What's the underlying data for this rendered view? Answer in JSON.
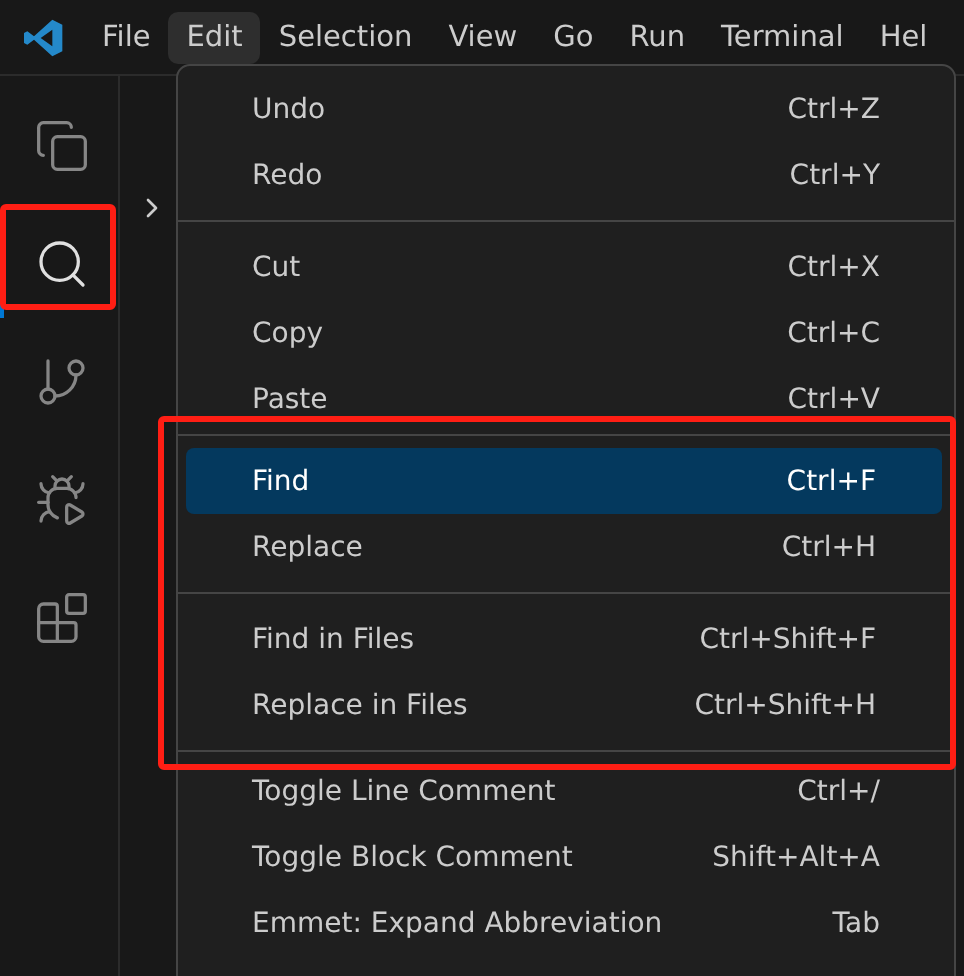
{
  "title_bar": {
    "menus": [
      {
        "label": "File",
        "selected": false
      },
      {
        "label": "Edit",
        "selected": true
      },
      {
        "label": "Selection",
        "selected": false
      },
      {
        "label": "View",
        "selected": false
      },
      {
        "label": "Go",
        "selected": false
      },
      {
        "label": "Run",
        "selected": false
      },
      {
        "label": "Terminal",
        "selected": false
      },
      {
        "label": "Hel",
        "selected": false
      }
    ]
  },
  "activity_bar": {
    "items": [
      {
        "kind": "files",
        "selected": false,
        "highlighted": false
      },
      {
        "kind": "search",
        "selected": true,
        "highlighted": true
      },
      {
        "kind": "source-control",
        "selected": false,
        "highlighted": false
      },
      {
        "kind": "run-debug",
        "selected": false,
        "highlighted": false
      },
      {
        "kind": "extensions",
        "selected": false,
        "highlighted": false
      }
    ]
  },
  "edit_menu": {
    "sections": [
      {
        "highlighted": false,
        "groups": [
          [
            {
              "label": "Undo",
              "shortcut": "Ctrl+Z",
              "selected": false
            },
            {
              "label": "Redo",
              "shortcut": "Ctrl+Y",
              "selected": false
            }
          ],
          [
            {
              "label": "Cut",
              "shortcut": "Ctrl+X",
              "selected": false
            },
            {
              "label": "Copy",
              "shortcut": "Ctrl+C",
              "selected": false
            },
            {
              "label": "Paste",
              "shortcut": "Ctrl+V",
              "selected": false
            }
          ]
        ]
      },
      {
        "highlighted": true,
        "groups": [
          [
            {
              "label": "Find",
              "shortcut": "Ctrl+F",
              "selected": true
            },
            {
              "label": "Replace",
              "shortcut": "Ctrl+H",
              "selected": false
            }
          ],
          [
            {
              "label": "Find in Files",
              "shortcut": "Ctrl+Shift+F",
              "selected": false
            },
            {
              "label": "Replace in Files",
              "shortcut": "Ctrl+Shift+H",
              "selected": false
            }
          ]
        ]
      },
      {
        "highlighted": false,
        "groups": [
          [
            {
              "label": "Toggle Line Comment",
              "shortcut": "Ctrl+/",
              "selected": false
            },
            {
              "label": "Toggle Block Comment",
              "shortcut": "Shift+Alt+A",
              "selected": false
            },
            {
              "label": "Emmet: Expand Abbreviation",
              "shortcut": "Tab",
              "selected": false
            }
          ]
        ]
      }
    ]
  }
}
